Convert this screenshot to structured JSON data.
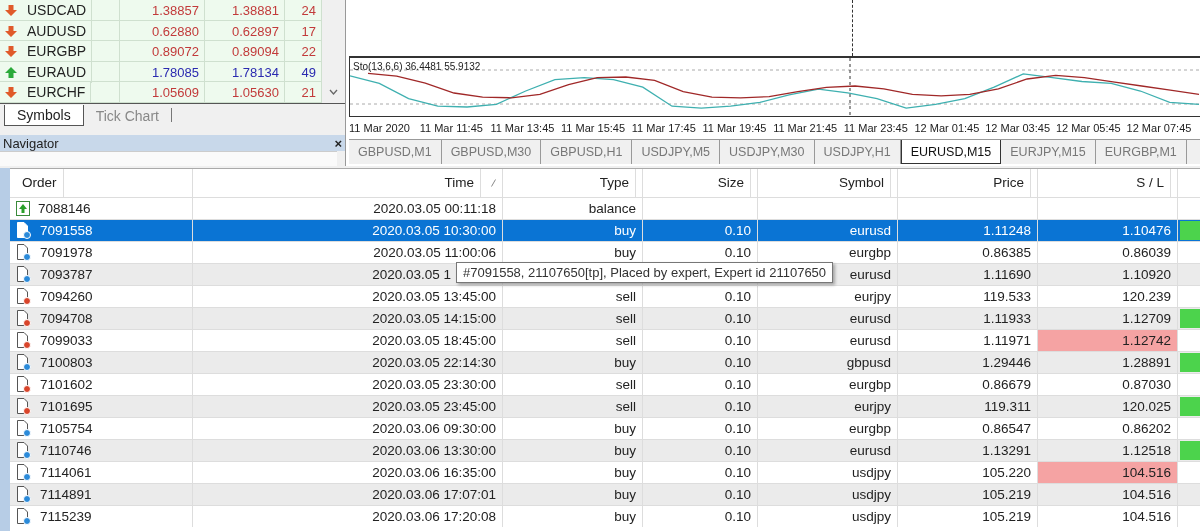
{
  "market_watch": {
    "rows": [
      {
        "symbol": "USDCAD",
        "bid": "1.38857",
        "ask": "1.38881",
        "spread": "24",
        "kind": "down"
      },
      {
        "symbol": "AUDUSD",
        "bid": "0.62880",
        "ask": "0.62897",
        "spread": "17",
        "kind": "down"
      },
      {
        "symbol": "EURGBP",
        "bid": "0.89072",
        "ask": "0.89094",
        "spread": "22",
        "kind": "down"
      },
      {
        "symbol": "EURAUD",
        "bid": "1.78085",
        "ask": "1.78134",
        "spread": "49",
        "kind": "up"
      },
      {
        "symbol": "EURCHF",
        "bid": "1.05609",
        "ask": "1.05630",
        "spread": "21",
        "kind": "down"
      }
    ],
    "tabs": [
      {
        "label": "Symbols",
        "selected": true
      },
      {
        "label": "Tick Chart",
        "selected": false
      }
    ]
  },
  "navigator": {
    "title": "Navigator",
    "close": "×"
  },
  "chart": {
    "indicator_label": "Sto(13,6,6) 36.4481 55.9132",
    "time_labels": [
      "11 Mar 2020",
      "11 Mar 11:45",
      "11 Mar 13:45",
      "11 Mar 15:45",
      "11 Mar 17:45",
      "11 Mar 19:45",
      "11 Mar 21:45",
      "11 Mar 23:45",
      "12 Mar 01:45",
      "12 Mar 03:45",
      "12 Mar 05:45",
      "12 Mar 07:45"
    ],
    "tabs": [
      {
        "label": "GBPUSD,M1",
        "selected": false
      },
      {
        "label": "GBPUSD,M30",
        "selected": false
      },
      {
        "label": "GBPUSD,H1",
        "selected": false
      },
      {
        "label": "USDJPY,M5",
        "selected": false
      },
      {
        "label": "USDJPY,M30",
        "selected": false
      },
      {
        "label": "USDJPY,H1",
        "selected": false
      },
      {
        "label": "EURUSD,M15",
        "selected": true
      },
      {
        "label": "EURJPY,M15",
        "selected": false
      },
      {
        "label": "EURGBP,M1",
        "selected": false
      }
    ]
  },
  "orders": {
    "columns": [
      "Order",
      "Time",
      "Type",
      "Size",
      "Symbol",
      "Price",
      "S / L"
    ],
    "rows": [
      {
        "kind": "balance",
        "order": "7088146",
        "time": "2020.03.05 00:11:18",
        "type": "balance",
        "selected": false
      },
      {
        "kind": "buy",
        "order": "7091558",
        "time": "2020.03.05 10:30:00",
        "type": "buy",
        "size": "0.10",
        "symbol": "eurusd",
        "price": "1.11248",
        "sl": "1.10476",
        "selected": true,
        "sl_alert": false,
        "marker": true
      },
      {
        "kind": "buy",
        "order": "7091978",
        "time": "2020.03.05 11:00:06",
        "type": "buy",
        "size": "0.10",
        "symbol": "eurgbp",
        "price": "0.86385",
        "sl": "0.86039",
        "selected": false,
        "sl_alert": false,
        "marker": false,
        "tooltip": "#7091558, 21107650[tp], Placed by expert, Expert id 21107650"
      },
      {
        "kind": "buy",
        "order": "7093787",
        "time": "2020.03.05 1",
        "symbol": "eurusd",
        "price": "1.11690",
        "sl": "1.10920",
        "selected": false,
        "sl_alert": false,
        "marker": false,
        "covered": true
      },
      {
        "kind": "sell",
        "order": "7094260",
        "time": "2020.03.05 13:45:00",
        "type": "sell",
        "size": "0.10",
        "symbol": "eurjpy",
        "price": "119.533",
        "sl": "120.239",
        "selected": false,
        "sl_alert": false,
        "marker": false
      },
      {
        "kind": "sell",
        "order": "7094708",
        "time": "2020.03.05 14:15:00",
        "type": "sell",
        "size": "0.10",
        "symbol": "eurusd",
        "price": "1.11933",
        "sl": "1.12709",
        "selected": false,
        "sl_alert": false,
        "marker": true
      },
      {
        "kind": "sell",
        "order": "7099033",
        "time": "2020.03.05 18:45:00",
        "type": "sell",
        "size": "0.10",
        "symbol": "eurusd",
        "price": "1.11971",
        "sl": "1.12742",
        "selected": false,
        "sl_alert": true,
        "marker": false
      },
      {
        "kind": "buy",
        "order": "7100803",
        "time": "2020.03.05 22:14:30",
        "type": "buy",
        "size": "0.10",
        "symbol": "gbpusd",
        "price": "1.29446",
        "sl": "1.28891",
        "selected": false,
        "sl_alert": false,
        "marker": true
      },
      {
        "kind": "sell",
        "order": "7101602",
        "time": "2020.03.05 23:30:00",
        "type": "sell",
        "size": "0.10",
        "symbol": "eurgbp",
        "price": "0.86679",
        "sl": "0.87030",
        "selected": false,
        "sl_alert": false,
        "marker": false
      },
      {
        "kind": "sell",
        "order": "7101695",
        "time": "2020.03.05 23:45:00",
        "type": "sell",
        "size": "0.10",
        "symbol": "eurjpy",
        "price": "119.311",
        "sl": "120.025",
        "selected": false,
        "sl_alert": false,
        "marker": true
      },
      {
        "kind": "buy",
        "order": "7105754",
        "time": "2020.03.06 09:30:00",
        "type": "buy",
        "size": "0.10",
        "symbol": "eurgbp",
        "price": "0.86547",
        "sl": "0.86202",
        "selected": false,
        "sl_alert": false,
        "marker": false
      },
      {
        "kind": "buy",
        "order": "7110746",
        "time": "2020.03.06 13:30:00",
        "type": "buy",
        "size": "0.10",
        "symbol": "eurusd",
        "price": "1.13291",
        "sl": "1.12518",
        "selected": false,
        "sl_alert": false,
        "marker": true
      },
      {
        "kind": "buy",
        "order": "7114061",
        "time": "2020.03.06 16:35:00",
        "type": "buy",
        "size": "0.10",
        "symbol": "usdjpy",
        "price": "105.220",
        "sl": "104.516",
        "selected": false,
        "sl_alert": true,
        "marker": false
      },
      {
        "kind": "buy",
        "order": "7114891",
        "time": "2020.03.06 17:07:01",
        "type": "buy",
        "size": "0.10",
        "symbol": "usdjpy",
        "price": "105.219",
        "sl": "104.516",
        "selected": false,
        "sl_alert": false,
        "marker": false
      },
      {
        "kind": "buy",
        "order": "7115239",
        "time": "2020.03.06 17:20:08",
        "type": "buy",
        "size": "0.10",
        "symbol": "usdjpy",
        "price": "105.219",
        "sl": "104.516",
        "selected": false,
        "sl_alert": false,
        "marker": false
      }
    ]
  }
}
